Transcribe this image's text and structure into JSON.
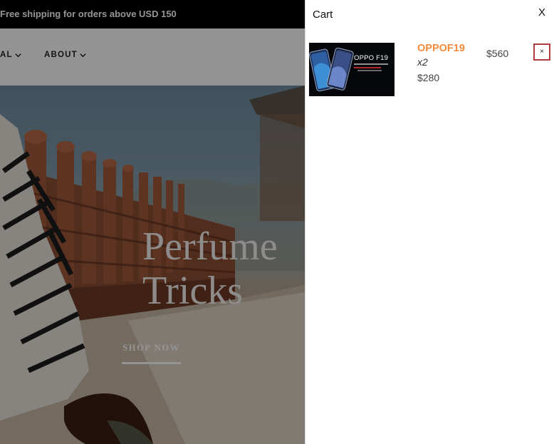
{
  "announcement": {
    "text": "Free shipping for orders above USD 150"
  },
  "nav": {
    "items": [
      {
        "label": "AL"
      },
      {
        "label": "ABOUT"
      }
    ]
  },
  "hero": {
    "title_line1": "Perfume",
    "title_line2": "Tricks",
    "cta_label": "SHOP NOW"
  },
  "cart": {
    "title": "Cart",
    "close_label": "X",
    "items": [
      {
        "name": "OPPOF19",
        "quantity": "x2",
        "unit_price": "$280",
        "total": "$560",
        "remove_label": "×",
        "thumbnail_text": "OPPO F19"
      }
    ]
  },
  "colors": {
    "product_name": "#f28a3c",
    "remove_border": "#b33a3a",
    "announcement_bg": "#000000"
  },
  "icons": [
    "chevron-down-icon",
    "close-icon",
    "remove-icon"
  ]
}
